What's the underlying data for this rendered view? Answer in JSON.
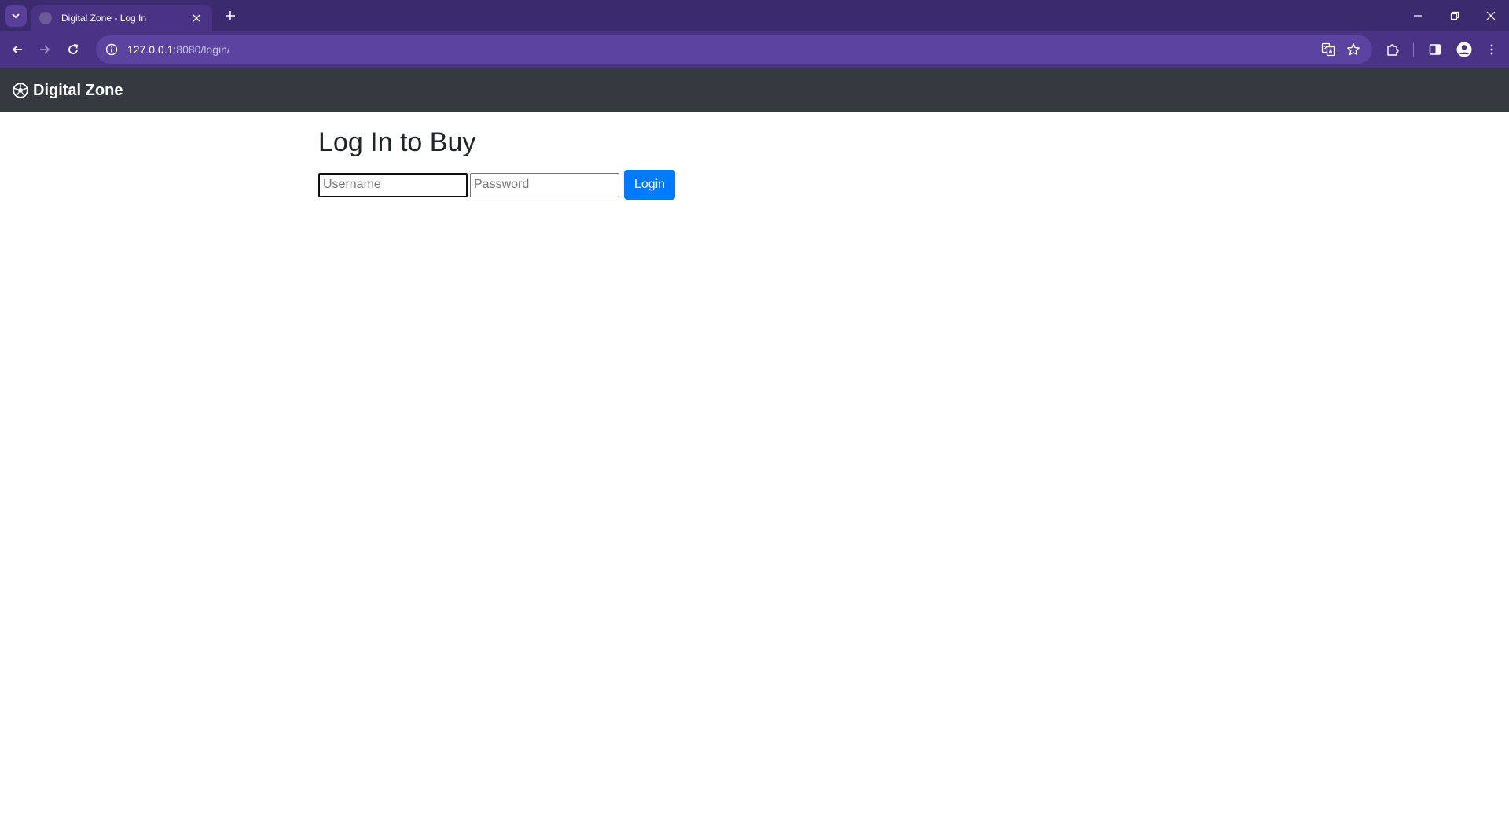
{
  "browser": {
    "tab": {
      "title": "Digital Zone - Log In",
      "favicon": "globe-icon"
    },
    "url": {
      "host": "127.0.0.1",
      "rest": ":8080/login/"
    },
    "icons": {
      "tab_search": "chevron-down-icon",
      "close_tab": "close-icon",
      "new_tab": "plus-icon",
      "back": "arrow-left-icon",
      "forward": "arrow-right-icon",
      "reload": "reload-icon",
      "site_info": "info-icon",
      "translate": "translate-icon",
      "bookmark": "star-icon",
      "extensions": "puzzle-icon",
      "side_panel": "side-panel-icon",
      "profile": "profile-icon",
      "menu": "kebab-menu-icon",
      "minimize": "minimize-icon",
      "restore": "restore-icon",
      "close_window": "close-icon"
    },
    "colors": {
      "frame": "#3c2a6e",
      "toolbar": "#4a3285"
    }
  },
  "navbar": {
    "brand": "Digital Zone",
    "brand_icon": "soccer-ball-icon",
    "background": "#343a40"
  },
  "main": {
    "title": "Log In to Buy",
    "username_placeholder": "Username",
    "password_placeholder": "Password",
    "username_value": "",
    "password_value": "",
    "login_label": "Login",
    "accent": "#007bff"
  }
}
